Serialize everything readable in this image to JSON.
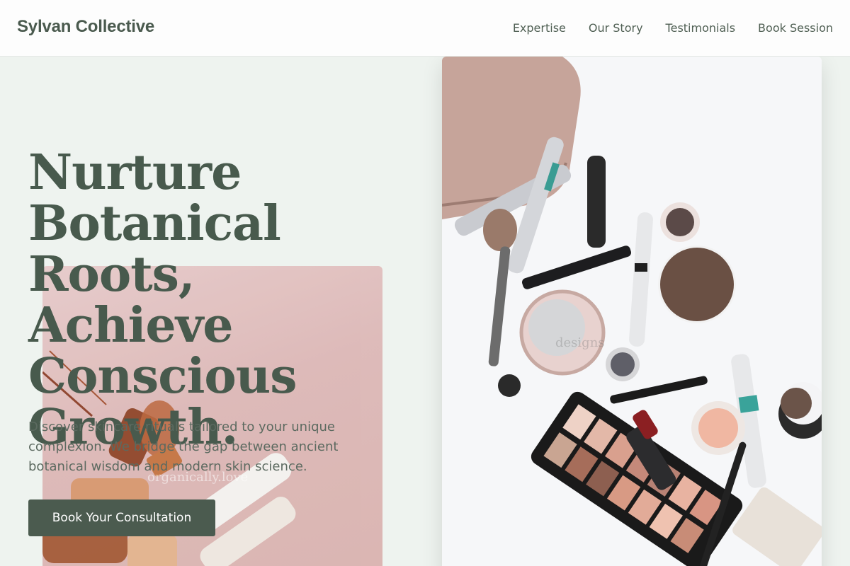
{
  "header": {
    "brand": "Sylvan Collective",
    "nav": [
      {
        "label": "Expertise"
      },
      {
        "label": "Our Story"
      },
      {
        "label": "Testimonials"
      },
      {
        "label": "Book Session"
      }
    ]
  },
  "hero": {
    "headline_lines": [
      "Nurture",
      "Botanical",
      "Roots, Achieve",
      "Conscious",
      "Growth."
    ],
    "subtitle": "Discover skincare rituals tailored to your unique complexion. We bridge the gap between ancient botanical wisdom and modern skin science.",
    "cta_label": "Book Your Consultation"
  },
  "images": {
    "pink_card_watermark": "organically.love",
    "photo_watermark": "designs"
  },
  "colors": {
    "primary_green": "#4b5b4f",
    "page_bg": "#eef3ef",
    "pink_card": "#dcb6b5"
  }
}
